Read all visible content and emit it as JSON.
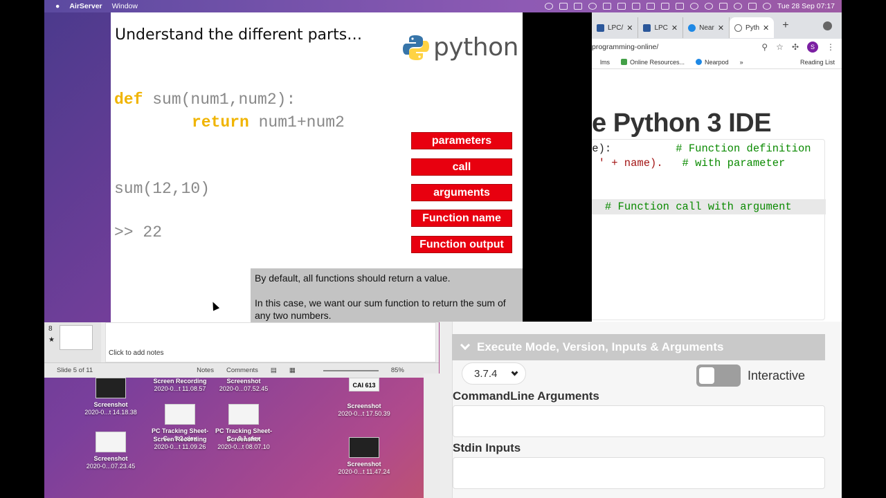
{
  "menubar": {
    "app": "AirServer",
    "window": "Window",
    "clock": "Tue 28 Sep  07:17"
  },
  "slide": {
    "title": "Understand the different parts…",
    "logo_text": "python",
    "logo_tm": "™",
    "code": {
      "def_kw": "def",
      "def_rest": " sum(num1,num2):",
      "return_kw": "return",
      "return_rest": " num1+num2",
      "call": "sum(12,10)",
      "output": ">> 22"
    },
    "labels": [
      "parameters",
      "call",
      "arguments",
      "Function name",
      "Function output"
    ],
    "note_p1": "By default, all functions should return a value.",
    "note_p2": "In this case, we want our sum function to return the sum of any two numbers."
  },
  "ppt": {
    "slide_num": "8",
    "star": "★",
    "notes_placeholder": "Click to add notes",
    "slide_count": "Slide 5 of 11",
    "notes_btn": "Notes",
    "comments_btn": "Comments",
    "zoom": "85%"
  },
  "desktop_icons": [
    {
      "name": "Screenshot",
      "sub": "2020-0...t 14.18.38"
    },
    {
      "name": "Screen Recording",
      "sub": "2020-0...t 11.08.57"
    },
    {
      "name": "Screenshot",
      "sub": "2020-0...07.52.45"
    },
    {
      "name": "CAI 613",
      "sub": ""
    },
    {
      "name": "Screenshot",
      "sub": "2020-0...t 17.50.39"
    },
    {
      "name": "PC Tracking Sheet-C....9.2.xlsx",
      "sub": ""
    },
    {
      "name": "PC Tracking Sheet-C....9.1.xlsx",
      "sub": ""
    },
    {
      "name": "Screen Recording",
      "sub": "2020-0...t 11.09.26"
    },
    {
      "name": "Screenshot",
      "sub": "2020-0...t 08.07.10"
    },
    {
      "name": "Screenshot",
      "sub": "2020-0...07.23.45"
    },
    {
      "name": "Screenshot",
      "sub": "2020-0...t 11.47.24"
    }
  ],
  "browser": {
    "tabs": [
      "LPC/",
      "LPC",
      "Near",
      "Pyth"
    ],
    "new_tab": "+",
    "url": "programming-online/",
    "avatar": "S",
    "bookmarks": [
      "lms",
      "Online Resources...",
      "Nearpod"
    ],
    "reading_list": "Reading List",
    "page_title": "e Python 3 IDE",
    "editor_lines": [
      {
        "code": "me):",
        "comment": "# Function definition"
      },
      {
        "code": "o ' + name).",
        "comment": "# with parameter"
      },
      {
        "code": ".",
        "comment": "# Function call with argument"
      }
    ]
  },
  "ide_panel": {
    "exec_title": "Execute Mode, Version, Inputs & Arguments",
    "version": "3.7.4",
    "interactive_label": "Interactive",
    "cmd_label": "CommandLine Arguments",
    "stdin_label": "Stdin Inputs"
  }
}
